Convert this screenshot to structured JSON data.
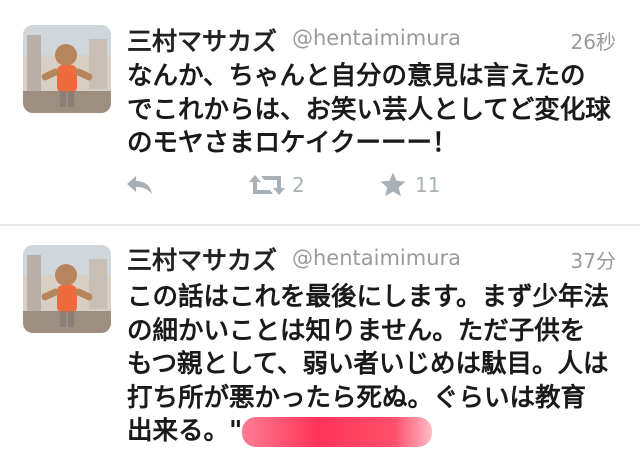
{
  "tweets": [
    {
      "name": "三村マサカズ",
      "handle": "@hentaimimura",
      "time": "26秒",
      "lines": [
        "なんか、ちゃんと自分の意見は言えたの",
        "でこれからは、お笑い芸人としてど変化球",
        "のモヤさまロケイクーーー！"
      ],
      "retweets": "2",
      "favorites": "11"
    },
    {
      "name": "三村マサカズ",
      "handle": "@hentaimimura",
      "time": "37分",
      "lines": [
        "この話はこれを最後にします。まず少年法",
        "の細かいことは知りません。ただ子供を",
        "もつ親として、弱い者いじめは駄目。人は",
        "打ち所が悪かったら死ぬ。ぐらいは教育",
        "出来る。\""
      ]
    }
  ],
  "icons": {
    "reply": "reply-icon",
    "retweet": "retweet-icon",
    "favorite": "star-icon"
  },
  "colors": {
    "action_gray": "#a9b1b8",
    "meta_gray": "#9a9a9a",
    "redaction": "#ff3c64"
  }
}
